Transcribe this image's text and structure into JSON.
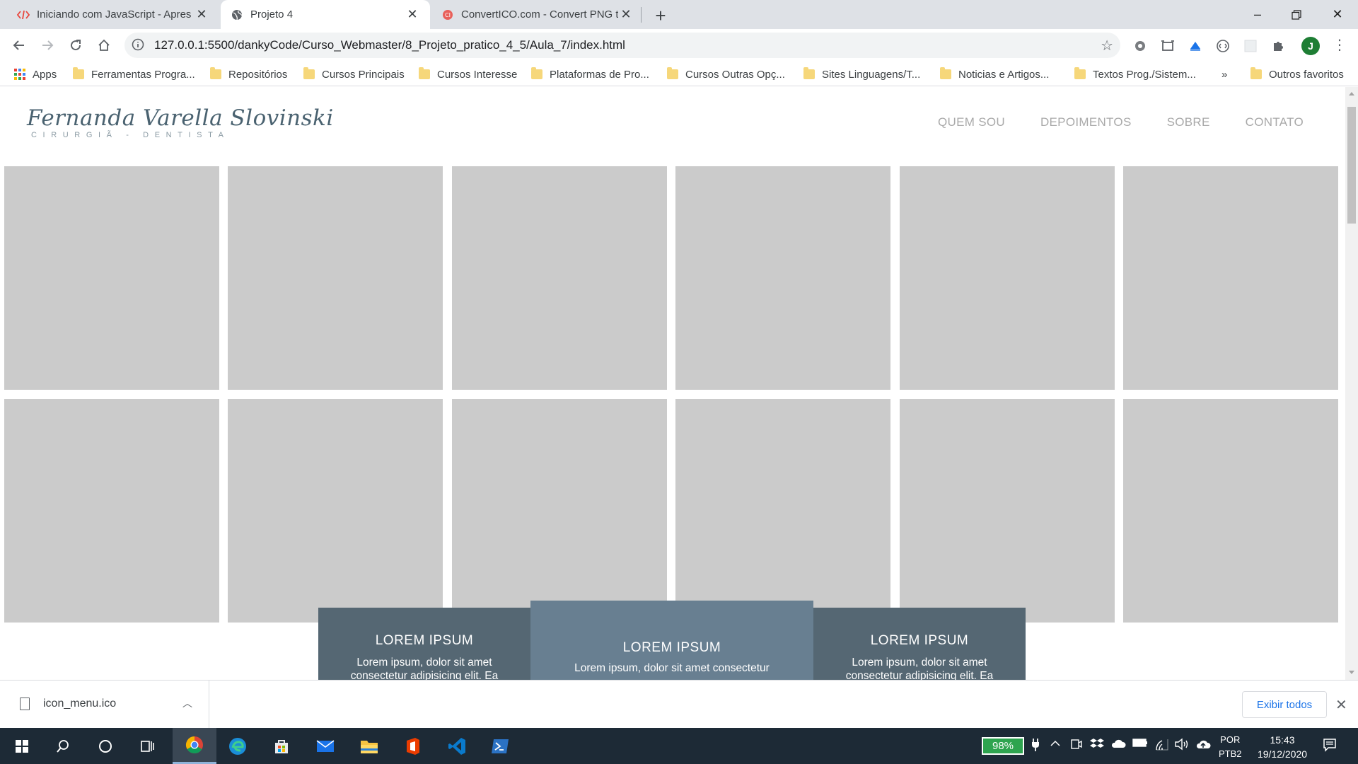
{
  "browser": {
    "tabs": [
      {
        "title": "Iniciando com JavaScript - Apres",
        "favicon": "code-icon",
        "active": false
      },
      {
        "title": "Projeto 4",
        "favicon": "globe-icon",
        "active": true
      },
      {
        "title": "ConvertICO.com - Convert PNG t",
        "favicon": "converticio-icon",
        "active": false
      }
    ],
    "url": "127.0.0.1:5500/dankyCode/Curso_Webmaster/8_Projeto_pratico_4_5/Aula_7/index.html",
    "profile_initial": "J"
  },
  "bookmarks": {
    "apps_label": "Apps",
    "items": [
      "Ferramentas Progra...",
      "Repositórios",
      "Cursos Principais",
      "Cursos Interesse",
      "Plataformas de Pro...",
      "Cursos Outras Opç...",
      "Sites Linguagens/T...",
      "Noticias e Artigos...",
      "Textos Prog./Sistem..."
    ],
    "overflow": "»",
    "other_label": "Outros favoritos"
  },
  "site": {
    "logo_script": "Fernanda Varella Slovinski",
    "logo_subtitle": "CIRURGIÃ - DENTISTA",
    "nav": [
      "QUEM SOU",
      "DEPOIMENTOS",
      "SOBRE",
      "CONTATO"
    ],
    "cards": [
      {
        "title": "LOREM IPSUM",
        "text": "Lorem ipsum, dolor sit amet consectetur adipisicing elit. Ea"
      },
      {
        "title": "LOREM IPSUM",
        "text": "Lorem ipsum, dolor sit amet consectetur"
      },
      {
        "title": "LOREM IPSUM",
        "text": "Lorem ipsum, dolor sit amet consectetur adipisicing elit. Ea"
      }
    ],
    "colors": {
      "tile": "#cbcbcb",
      "card_side": "#556773",
      "card_mid": "#687f91",
      "nav_text": "#a9a9a9"
    }
  },
  "downloads": {
    "file_name": "icon_menu.ico",
    "show_all_label": "Exibir todos"
  },
  "taskbar": {
    "battery": "98%",
    "language_top": "POR",
    "language_bottom": "PTB2",
    "time": "15:43",
    "date": "19/12/2020"
  }
}
